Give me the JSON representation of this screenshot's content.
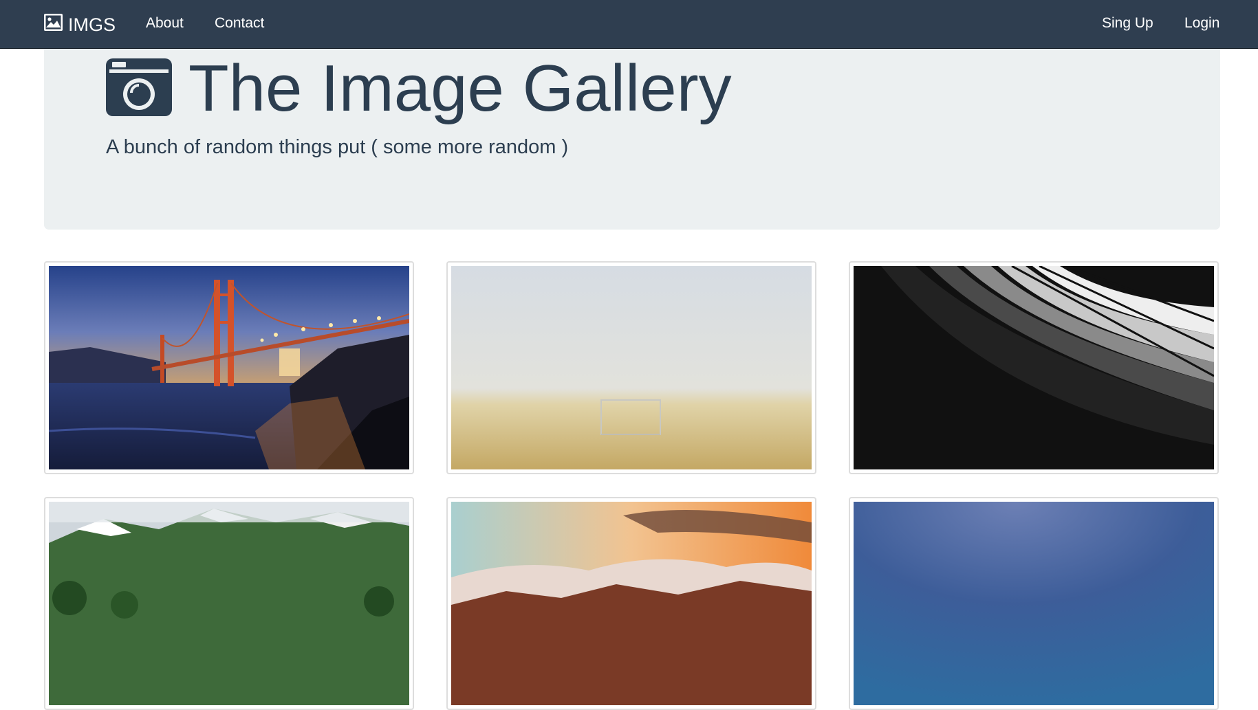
{
  "navbar": {
    "brand": {
      "icon": "image-icon",
      "label": "IMGS"
    },
    "links": [
      "About",
      "Contact"
    ],
    "right_links": [
      "Sing Up",
      "Login"
    ]
  },
  "hero": {
    "icon": "camera-icon",
    "title": "The Image Gallery",
    "lead": "A bunch of random things put ( some more random )"
  },
  "gallery": {
    "images": [
      {
        "subject": "golden-gate-bridge-at-dusk"
      },
      {
        "subject": "foggy-football-field-goal"
      },
      {
        "subject": "abstract-architecture-black-white"
      },
      {
        "subject": "green-mountains-with-snow"
      },
      {
        "subject": "sunset-over-clouds-and-mountains"
      },
      {
        "subject": "clear-blue-sky"
      }
    ]
  },
  "colors": {
    "navbar_bg": "#2f3e50",
    "jumbotron_bg": "#ecf0f1",
    "text": "#2c3e50"
  }
}
